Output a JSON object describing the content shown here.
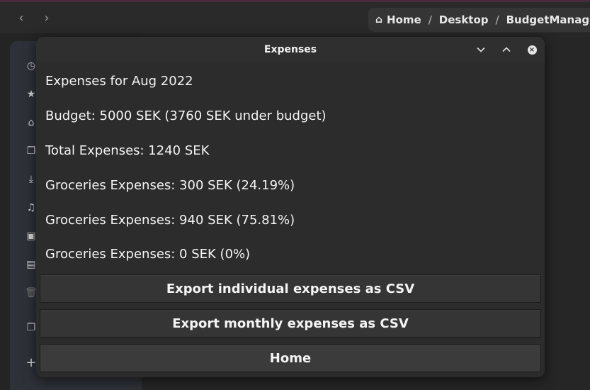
{
  "file_manager": {
    "breadcrumb": [
      "Home",
      "Desktop",
      "BudgetManager"
    ],
    "sidebar_icons": [
      "clock-icon",
      "star-icon",
      "home-icon",
      "documents-icon",
      "download-icon",
      "music-icon",
      "pictures-icon",
      "videos-icon",
      "trash-icon",
      "copy-icon",
      "plus-icon"
    ]
  },
  "dialog": {
    "title": "Expenses",
    "lines": [
      "Expenses for Aug 2022",
      "Budget: 5000 SEK (3760 SEK under budget)",
      "Total Expenses: 1240 SEK",
      "Groceries Expenses: 300 SEK (24.19%)",
      "Groceries Expenses: 940 SEK (75.81%)",
      "Groceries Expenses: 0 SEK (0%)"
    ],
    "buttons": {
      "export_individual": "Export individual expenses as CSV",
      "export_monthly": "Export monthly expenses as CSV",
      "home": "Home"
    }
  }
}
